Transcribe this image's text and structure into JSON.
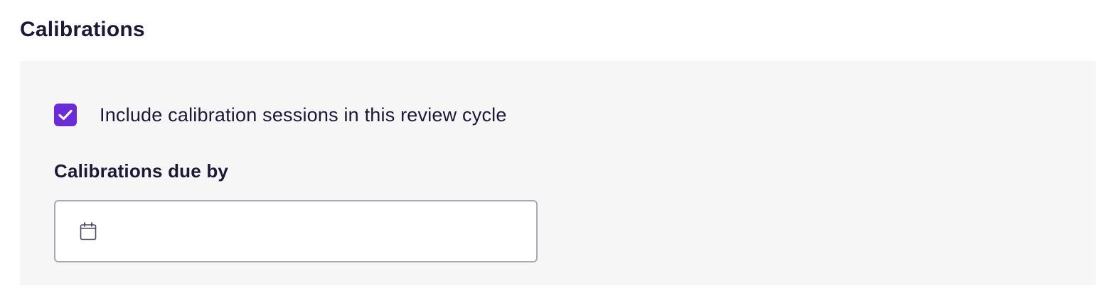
{
  "section": {
    "title": "Calibrations"
  },
  "calibration_option": {
    "label": "Include calibration sessions in this review cycle",
    "checked": true
  },
  "due_date": {
    "label": "Calibrations due by",
    "value": "",
    "icon": "calendar-icon"
  },
  "colors": {
    "accent": "#6a2bd8",
    "panel_background": "#f6f6f6",
    "text": "#1c1836",
    "input_border": "#a9a8b8"
  }
}
